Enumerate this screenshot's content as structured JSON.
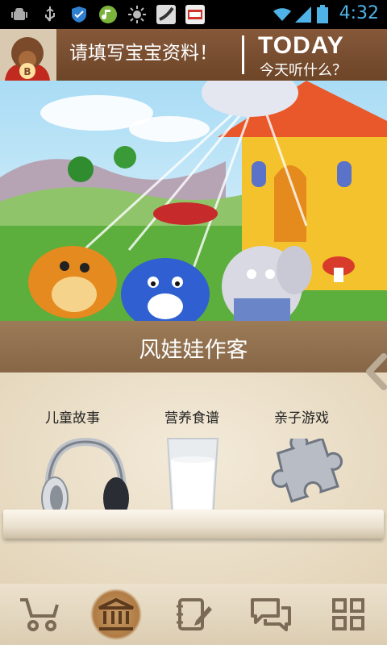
{
  "status_bar": {
    "time": "4:32",
    "icons": [
      "android-debug-icon",
      "usb-icon",
      "shield-icon",
      "music-app-icon",
      "brightness-icon",
      "peas-app-icon",
      "sms-app-icon",
      "wifi-icon",
      "signal-icon",
      "battery-icon"
    ]
  },
  "header": {
    "title": "请填写宝宝资料！",
    "today": "TODAY",
    "today_subtitle": "今天听什么？"
  },
  "banner": {
    "caption": "风娃娃作客"
  },
  "categories": [
    {
      "label": "儿童故事",
      "icon": "headphones-icon"
    },
    {
      "label": "营养食谱",
      "icon": "milk-glass-icon"
    },
    {
      "label": "亲子游戏",
      "icon": "puzzle-piece-icon"
    }
  ],
  "bottom_nav": {
    "items": [
      "stroller-icon",
      "library-icon",
      "notebook-icon",
      "chat-icon",
      "grid-icon"
    ],
    "active_index": 1
  },
  "colors": {
    "header_bg": "#7a4e2c",
    "caption_bg": "#937351",
    "clock": "#4fb3e8",
    "nav_active": "#b07b44"
  }
}
